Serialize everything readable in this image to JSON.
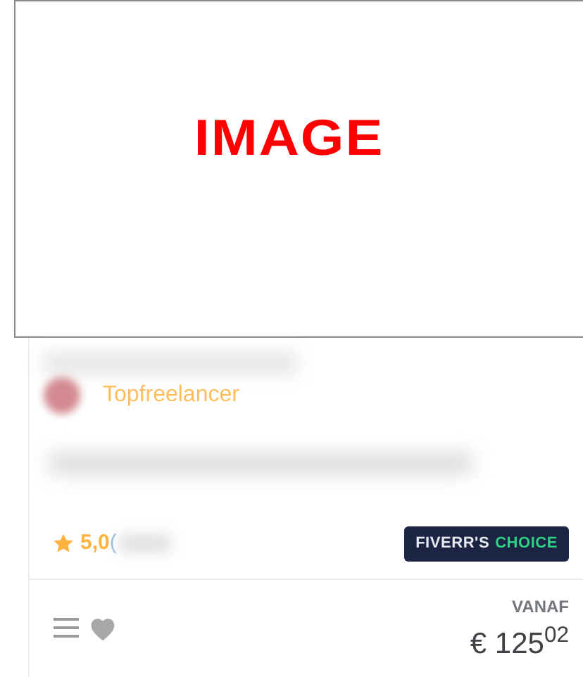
{
  "image": {
    "label": "IMAGE"
  },
  "seller": {
    "level": "Topfreelancer"
  },
  "rating": {
    "score": "5,0",
    "open_paren": "("
  },
  "badge": {
    "first": "FIVERR'S",
    "second": "CHOICE"
  },
  "footer": {
    "price_label": "VANAF",
    "price": "€ 125$^{02}$"
  }
}
